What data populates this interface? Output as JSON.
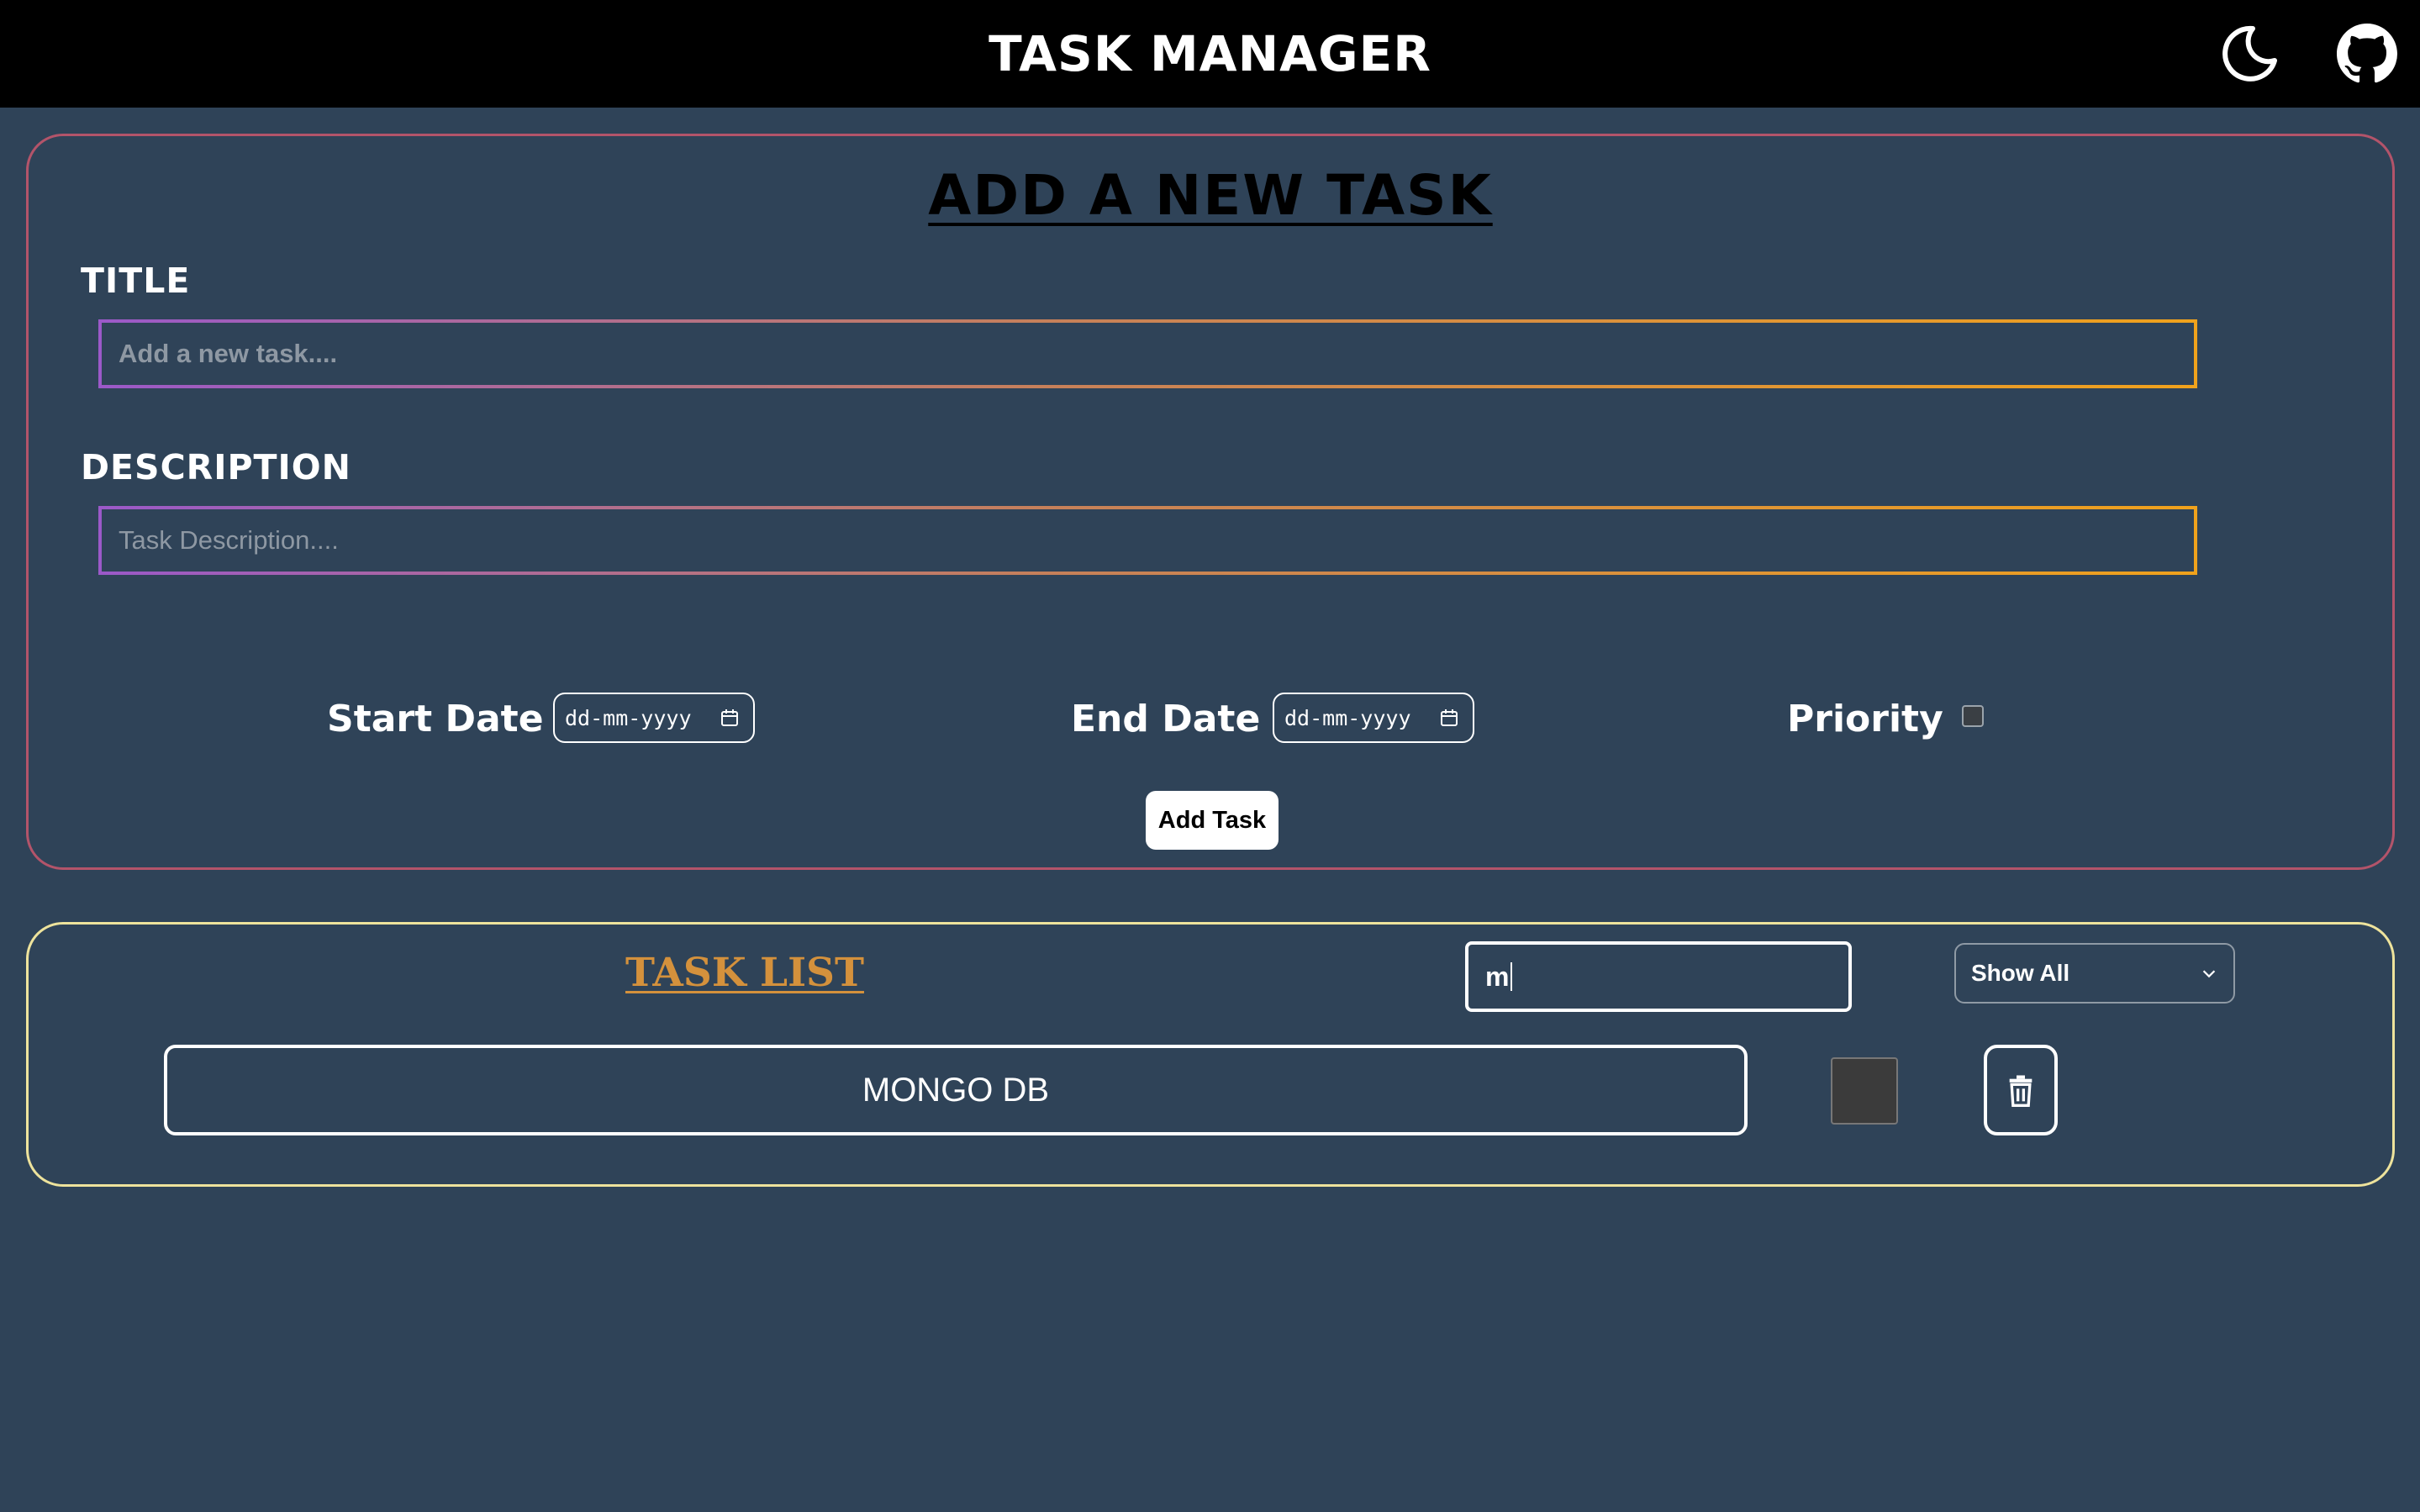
{
  "header": {
    "title": "TASK MANAGER",
    "icons": [
      "moon-icon",
      "github-icon"
    ]
  },
  "add_task": {
    "heading": "ADD A NEW TASK",
    "title_label": "TITLE",
    "title_placeholder": "Add a new task....",
    "title_value": "",
    "description_label": "DESCRIPTION",
    "description_placeholder": "Task Description....",
    "description_value": "",
    "start_date_label": "Start Date",
    "start_date_value": "dd-mm-yyyy",
    "end_date_label": "End Date",
    "end_date_value": "dd-mm-yyyy",
    "priority_label": "Priority",
    "priority_checked": false,
    "add_button_label": "Add Task"
  },
  "task_list": {
    "heading": "TASK LIST",
    "search_value": "m",
    "filter_selected": "Show All",
    "tasks": [
      {
        "title": "MONGO DB",
        "completed": false
      }
    ]
  },
  "colors": {
    "background": "#2f4358",
    "header": "#000000",
    "add_panel_border": "#b3546a",
    "list_panel_border": "#eee39c",
    "list_heading": "#d4913c",
    "input_gradient_start": "#9b59c9",
    "input_gradient_end": "#f0a21c"
  }
}
